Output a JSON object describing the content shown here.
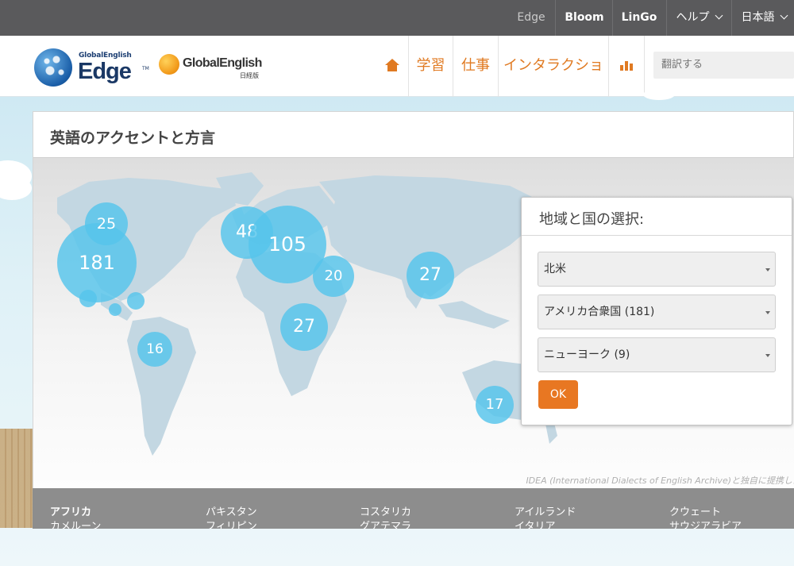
{
  "topbar": {
    "edge": "Edge",
    "bloom": "Bloom",
    "lingo": "LinGo",
    "help": "ヘルプ",
    "language": "日本語"
  },
  "header": {
    "logo_edge_small": "GlobalEnglish",
    "logo_edge_big": "Edge",
    "logo_ge_name": "GlobalEnglish",
    "logo_ge_sub": "日経版",
    "nav": {
      "learn": "学習",
      "work": "仕事",
      "interaction": "インタラクション"
    },
    "search_placeholder": "翻訳する"
  },
  "panel": {
    "title": "英語のアクセントと方言",
    "credit": "IDEA (International Dialects of English Archive)と独自に提携した音声記録"
  },
  "map": {
    "bubbles": [
      {
        "value": "181"
      },
      {
        "value": "25"
      },
      {
        "value": ""
      },
      {
        "value": ""
      },
      {
        "value": ""
      },
      {
        "value": "16"
      },
      {
        "value": "48"
      },
      {
        "value": "105"
      },
      {
        "value": "20"
      },
      {
        "value": "27"
      },
      {
        "value": "27"
      },
      {
        "value": "17"
      }
    ]
  },
  "selector": {
    "title": "地域と国の選択:",
    "region": "北米",
    "country": "アメリカ合衆国 (181)",
    "city": "ニューヨーク (9)",
    "ok": "OK"
  },
  "countries": {
    "col1": [
      "アフリカ",
      "カメルーン"
    ],
    "col2": [
      "パキスタン",
      "フィリピン"
    ],
    "col3": [
      "コスタリカ",
      "グアテマラ"
    ],
    "col4": [
      "アイルランド",
      "イタリア"
    ],
    "col5": [
      "クウェート",
      "サウジアラビア"
    ]
  },
  "colors": {
    "accent": "#e87722",
    "bubble": "#56c4ec",
    "topbar": "#5a5a5c"
  }
}
